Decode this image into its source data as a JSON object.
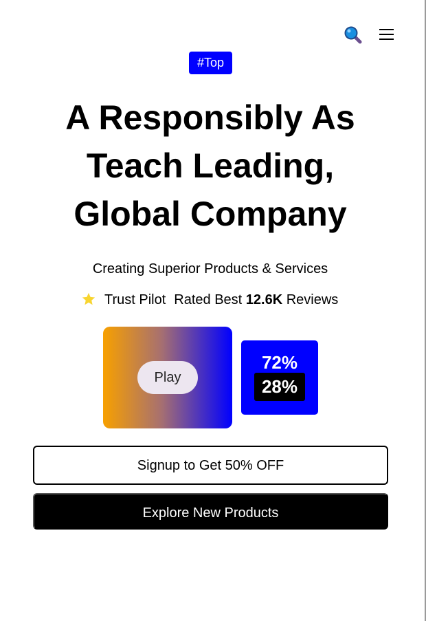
{
  "header": {
    "icons": [
      "search-icon",
      "menu-icon"
    ]
  },
  "hero": {
    "tag": "#Top",
    "headline": "A Responsibly As Teach Leading, Global Company",
    "subtitle": "Creating Superior Products & Services",
    "rating": {
      "icon": "star-icon",
      "source": "Trust Pilot",
      "prefix": "Rated Best",
      "count": "12.6K",
      "suffix": "Reviews"
    }
  },
  "media": {
    "play_label": "Play",
    "stats": {
      "primary": "72%",
      "secondary": "28%"
    }
  },
  "actions": {
    "signup_label": "Signup to Get 50% OFF",
    "explore_label": "Explore New Products"
  },
  "colors": {
    "accent": "#0000ff",
    "star": "#f8d530",
    "gradient_start": "#f7a000",
    "gradient_end": "#0000ff",
    "button_dark": "#000000"
  }
}
